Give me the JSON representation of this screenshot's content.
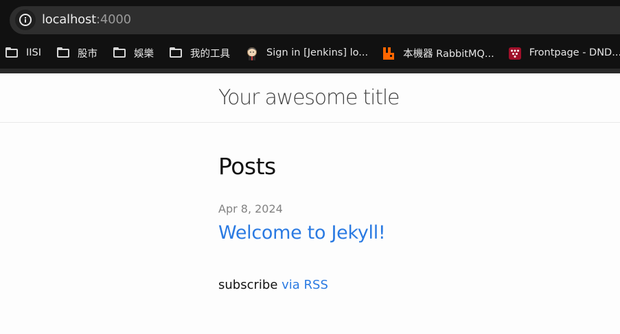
{
  "browser": {
    "url_host": "localhost",
    "url_port": ":4000",
    "bookmarks": [
      {
        "label": "IISI",
        "icon": "folder-icon"
      },
      {
        "label": "股市",
        "icon": "folder-icon"
      },
      {
        "label": "娛樂",
        "icon": "folder-icon"
      },
      {
        "label": "我的工具",
        "icon": "folder-icon"
      },
      {
        "label": "Sign in [Jenkins] lo...",
        "icon": "jenkins-icon"
      },
      {
        "label": "本機器 RabbitMQ...",
        "icon": "rabbitmq-icon"
      },
      {
        "label": "Frontpage - DND...",
        "icon": "dnd-icon"
      }
    ]
  },
  "site": {
    "title": "Your awesome title"
  },
  "main": {
    "heading": "Posts",
    "posts": [
      {
        "date": "Apr 8, 2024",
        "title": "Welcome to Jekyll!"
      }
    ],
    "subscribe_text": "subscribe",
    "subscribe_link": "via RSS"
  },
  "colors": {
    "link": "#2a7ae2",
    "meta": "#828282",
    "chrome_bg": "#111111"
  }
}
